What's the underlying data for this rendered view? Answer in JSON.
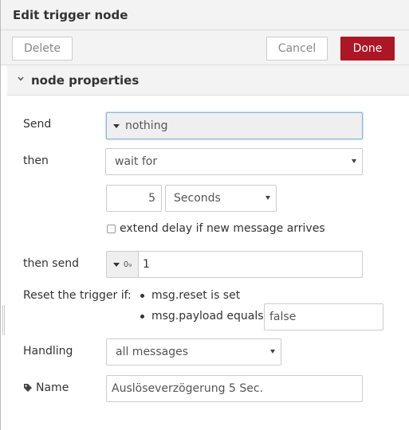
{
  "header": {
    "title": "Edit trigger node"
  },
  "toolbar": {
    "delete_label": "Delete",
    "cancel_label": "Cancel",
    "done_label": "Done"
  },
  "section": {
    "title": "node properties"
  },
  "form": {
    "send_label": "Send",
    "send_value": "nothing",
    "then_label": "then",
    "then_value": "wait for",
    "duration_value": "5",
    "duration_units": "Seconds",
    "extend_label": "extend delay if new message arrives",
    "extend_checked": false,
    "then_send_label": "then send",
    "then_send_type_icon": "0₉",
    "then_send_value": "1",
    "reset_label": "Reset the trigger if:",
    "reset_item1": "msg.reset is set",
    "reset_item2": "msg.payload equals",
    "reset_payload_value": "false",
    "handling_label": "Handling",
    "handling_value": "all messages",
    "name_label": "Name",
    "name_icon": "tag-icon",
    "name_value": "Auslöseverzögerung 5 Sec."
  },
  "colors": {
    "done_bg": "#ad1625",
    "focus_border": "#85b7d9",
    "header_bg": "#f3f3f3"
  }
}
